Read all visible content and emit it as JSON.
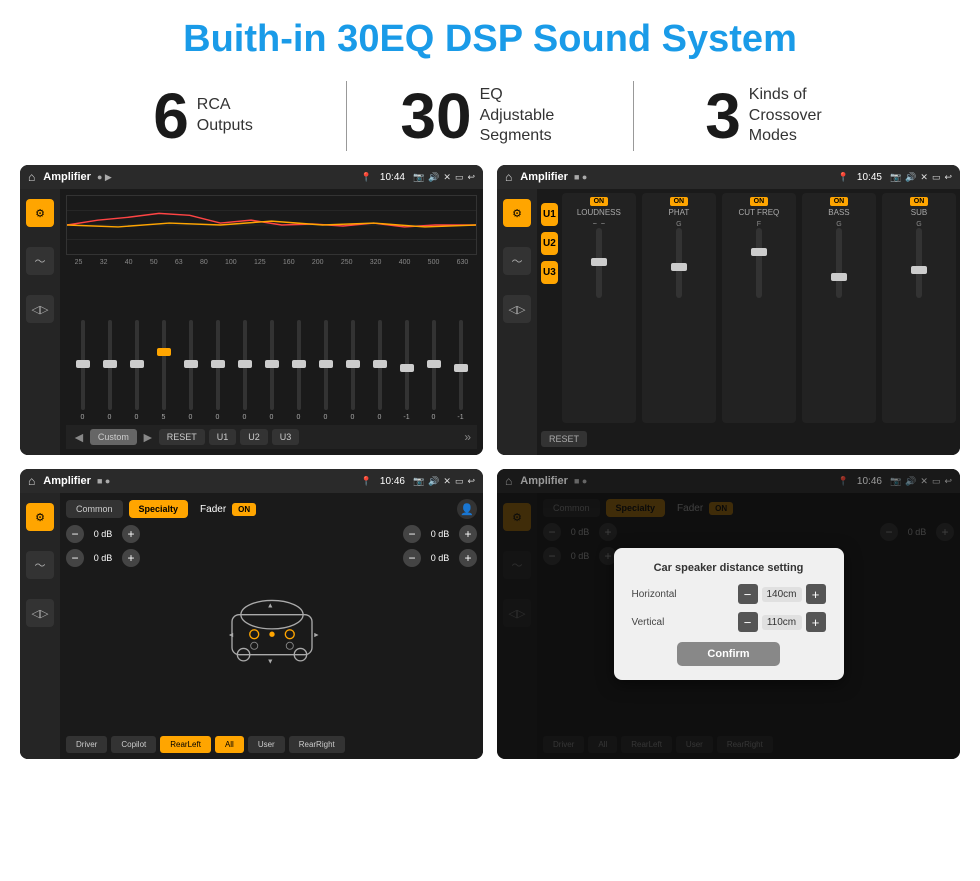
{
  "page": {
    "title": "Buith-in 30EQ DSP Sound System",
    "stats": [
      {
        "number": "6",
        "label": "RCA\nOutputs"
      },
      {
        "number": "30",
        "label": "EQ Adjustable\nSegments"
      },
      {
        "number": "3",
        "label": "Kinds of\nCrossover Modes"
      }
    ]
  },
  "screens": {
    "eq": {
      "app": "Amplifier",
      "time": "10:44",
      "frequencies": [
        "25",
        "32",
        "40",
        "50",
        "63",
        "80",
        "100",
        "125",
        "160",
        "200",
        "250",
        "320",
        "400",
        "500",
        "630"
      ],
      "values": [
        "0",
        "0",
        "0",
        "5",
        "0",
        "0",
        "0",
        "0",
        "0",
        "0",
        "0",
        "0",
        "-1",
        "0",
        "-1"
      ],
      "bottom_buttons": [
        "Custom",
        "RESET",
        "U1",
        "U2",
        "U3"
      ]
    },
    "mixer": {
      "app": "Amplifier",
      "time": "10:45",
      "channels": [
        {
          "id": "U1",
          "label": "LOUDNESS",
          "on": true
        },
        {
          "id": "U2",
          "label": "PHAT",
          "on": true
        },
        {
          "id": "U3",
          "label": "CUT FREQ",
          "on": true
        },
        {
          "id": "",
          "label": "BASS",
          "on": true
        },
        {
          "id": "",
          "label": "SUB",
          "on": true
        }
      ],
      "reset_label": "RESET"
    },
    "fader": {
      "app": "Amplifier",
      "time": "10:46",
      "tabs": [
        "Common",
        "Specialty"
      ],
      "active_tab": "Specialty",
      "fader_label": "Fader",
      "on_badge": "ON",
      "db_values": [
        "0 dB",
        "0 dB",
        "0 dB",
        "0 dB"
      ],
      "bottom_buttons": [
        "Driver",
        "Copilot",
        "RearLeft",
        "All",
        "User",
        "RearRight"
      ]
    },
    "dialog": {
      "app": "Amplifier",
      "time": "10:46",
      "tabs": [
        "Common",
        "Specialty"
      ],
      "active_tab": "Specialty",
      "dialog_title": "Car speaker distance setting",
      "horizontal_label": "Horizontal",
      "horizontal_value": "140cm",
      "vertical_label": "Vertical",
      "vertical_value": "110cm",
      "db_right_values": [
        "0 dB",
        "0 dB"
      ],
      "confirm_label": "Confirm"
    }
  }
}
